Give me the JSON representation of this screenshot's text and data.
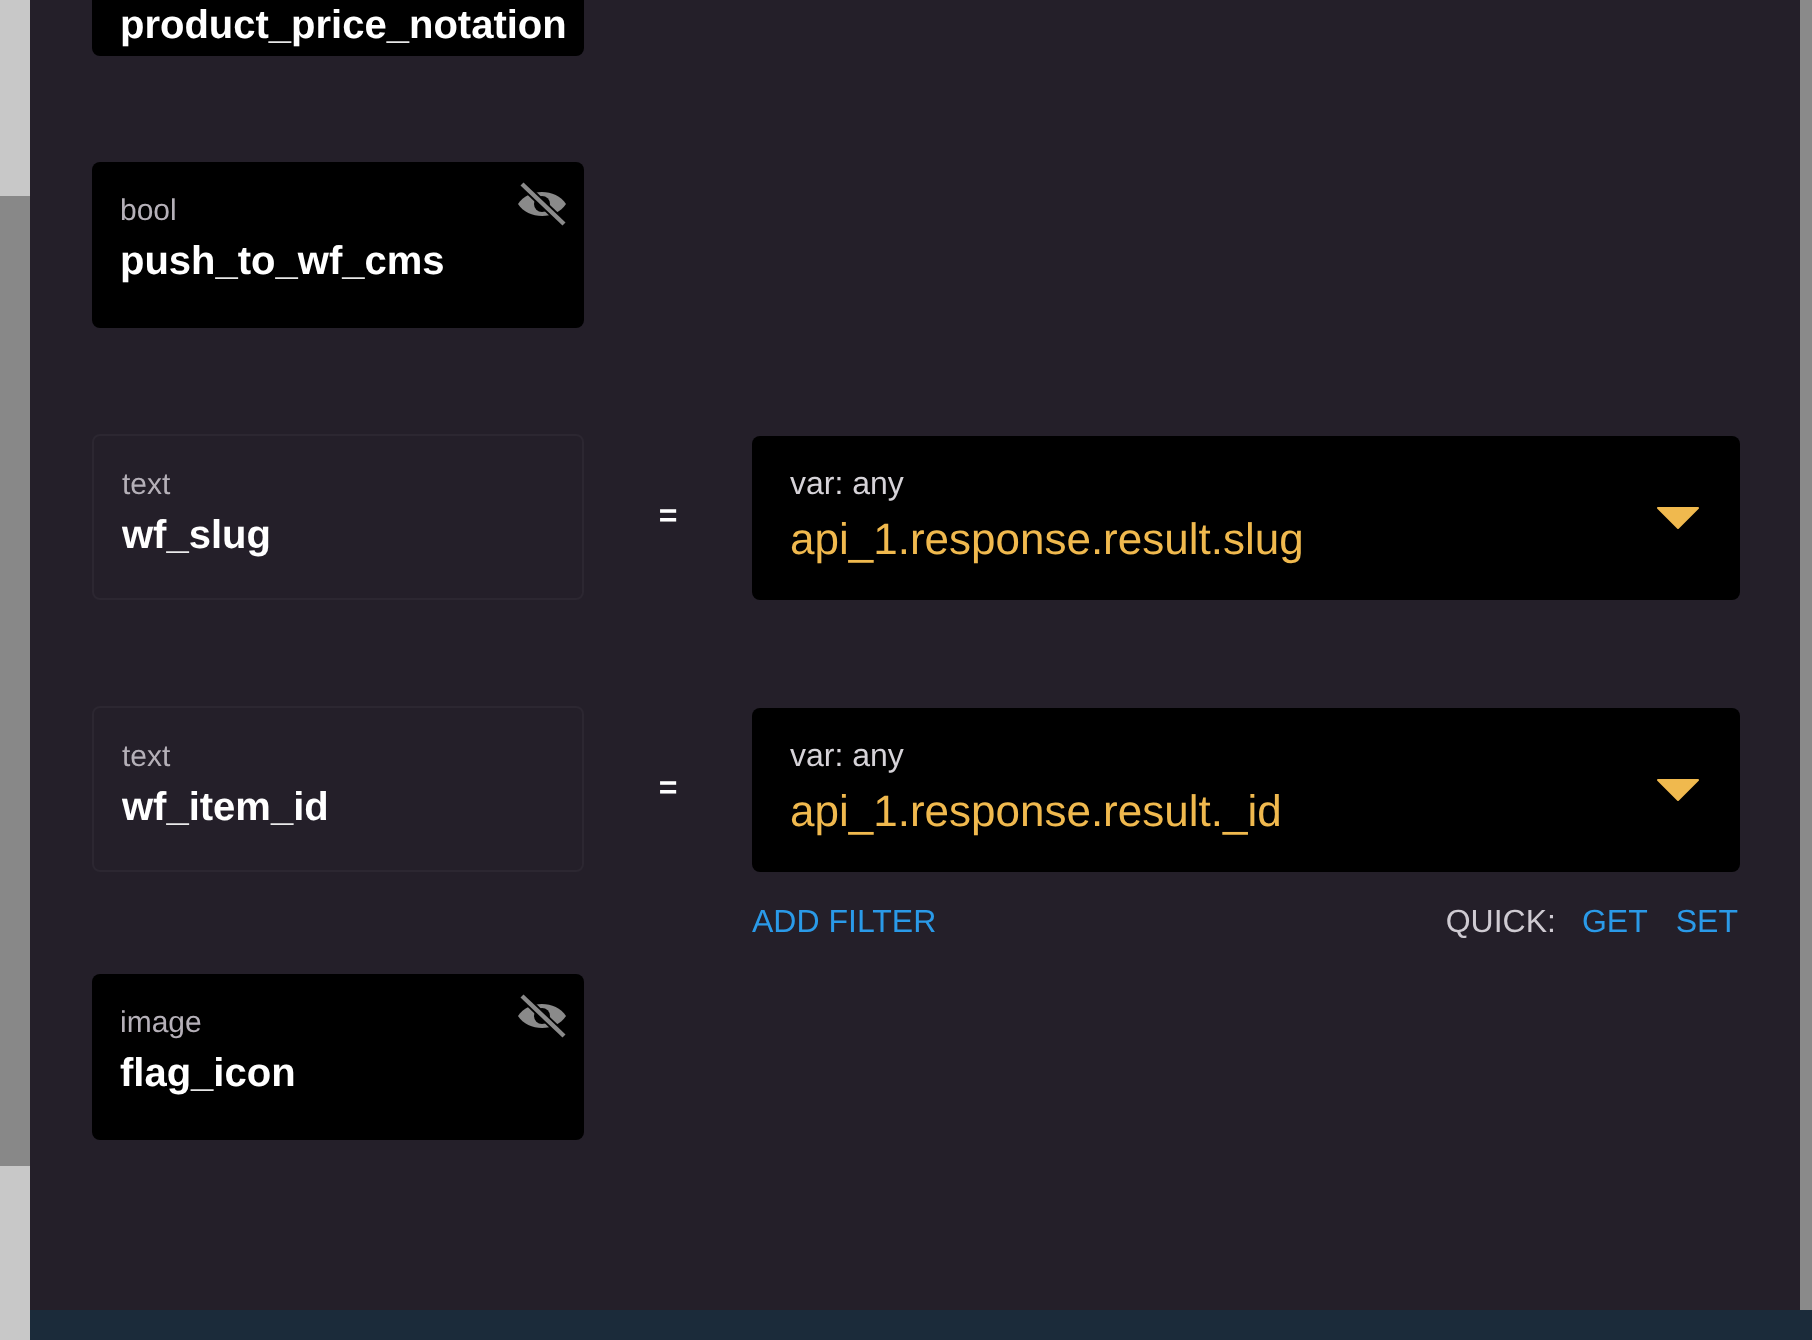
{
  "fields": [
    {
      "kind": "hidden",
      "name": "product_price_notation"
    },
    {
      "kind": "hidden",
      "type": "bool",
      "name": "push_to_wf_cms",
      "hidden": true
    },
    {
      "kind": "mapped",
      "type": "text",
      "name": "wf_slug",
      "operator": "=",
      "value_label": "var: any",
      "value": "api_1.response.result.slug"
    },
    {
      "kind": "mapped",
      "type": "text",
      "name": "wf_item_id",
      "operator": "=",
      "value_label": "var: any",
      "value": "api_1.response.result._id",
      "actions": {
        "add_filter": "ADD FILTER",
        "quick_label": "QUICK:",
        "get": "GET",
        "set": "SET"
      }
    },
    {
      "kind": "hidden",
      "type": "image",
      "name": "flag_icon",
      "hidden": true
    }
  ]
}
